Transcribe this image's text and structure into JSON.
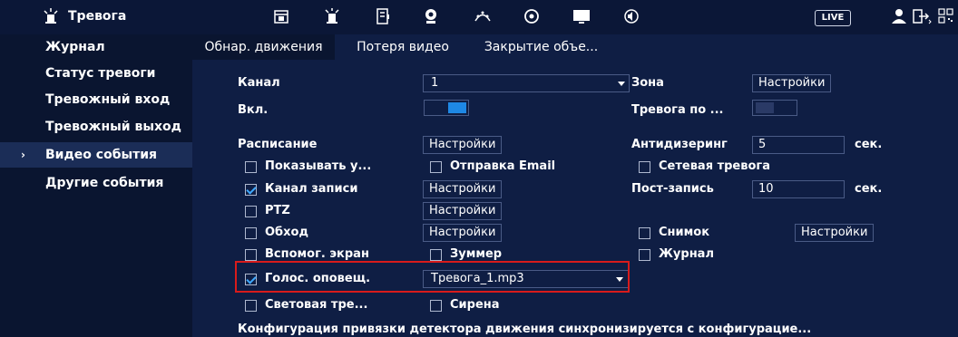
{
  "app": {
    "title": "Тревога",
    "live_label": "LIVE"
  },
  "topbar": {
    "icons": [
      "alarm-icon",
      "calendar-icon",
      "alarm-bell-icon",
      "storage-icon",
      "camera-icon",
      "network-icon",
      "ptz-icon",
      "display-icon",
      "audio-icon",
      "user-icon",
      "logout-icon",
      "qr-icon"
    ]
  },
  "sidebar": {
    "items": [
      {
        "label": "Журнал"
      },
      {
        "label": "Статус тревоги"
      },
      {
        "label": "Тревожный вход"
      },
      {
        "label": "Тревожный выход"
      },
      {
        "label": "Видео события"
      },
      {
        "label": "Другие события"
      }
    ],
    "active_index": 4
  },
  "tabs": [
    {
      "label": "Обнар. движения"
    },
    {
      "label": "Потеря видео"
    },
    {
      "label": "Закрытие объе..."
    }
  ],
  "form": {
    "channel_label": "Канал",
    "channel_value": "1",
    "zone_label": "Зона",
    "zone_button": "Настройки",
    "enable_label": "Вкл.",
    "alarm_label": "Тревога по ...",
    "schedule_label": "Расписание",
    "schedule_button": "Настройки",
    "antidither_label": "Антидизеринг",
    "antidither_value": "5",
    "antidither_unit": "сек.",
    "show_label": "Показывать у...",
    "email_label": "Отправка Email",
    "netalarm_label": "Сетевая тревога",
    "record_label": "Канал записи",
    "record_button": "Настройки",
    "postrec_label": "Пост-запись",
    "postrec_value": "10",
    "postrec_unit": "сек.",
    "ptz_label": "PTZ",
    "ptz_button": "Настройки",
    "tour_label": "Обход",
    "tour_button": "Настройки",
    "snapshot_label": "Снимок",
    "snapshot_button": "Настройки",
    "aux_label": "Вспомог. экран",
    "buzzer_label": "Зуммер",
    "log_label": "Журнал",
    "voice_label": "Голос. оповещ.",
    "voice_value": "Тревога_1.mp3",
    "light_label": "Световая тре...",
    "siren_label": "Сирена",
    "footer_note": "Конфигурация привязки детектора движения синхронизируется с конфигурацие..."
  },
  "colors": {
    "accent": "#1e88e5",
    "highlight": "#d81b1b"
  }
}
